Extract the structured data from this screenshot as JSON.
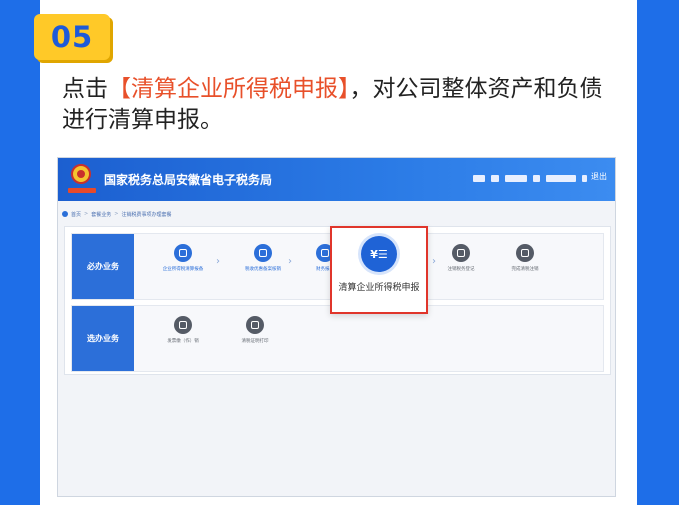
{
  "step": {
    "number": "05"
  },
  "instruction": {
    "prefix": "点击",
    "highlight": "【清算企业所得税申报】",
    "suffix": "，对公司整体资产和负债进行清算申报。"
  },
  "screenshot": {
    "site_title": "国家税务总局安徽省电子税务局",
    "header_exit": "退出",
    "breadcrumb": [
      "首页",
      "套餐业务",
      "注销税费事项办理套餐"
    ],
    "required": {
      "label": "必办业务",
      "items": [
        {
          "label": "企业所得税清算报备",
          "icon": "doc-edit-icon"
        },
        {
          "label": "税收优惠备案核销",
          "icon": "doc-edit-icon"
        },
        {
          "label": "财务报表",
          "icon": "clipboard-icon"
        },
        {
          "label": "注销税务登记",
          "icon": "building-icon"
        },
        {
          "label": "完成清税注销",
          "icon": "checkbox-icon"
        }
      ],
      "highlighted": {
        "label": "清算企业所得税申报",
        "icon_text": "¥☰"
      }
    },
    "optional": {
      "label": "选办业务",
      "items": [
        {
          "label": "发票缴（作）销",
          "icon": "stamp-icon"
        },
        {
          "label": "清税证明打印",
          "icon": "print-icon"
        }
      ]
    }
  },
  "colors": {
    "background": "#1e6ee8",
    "badge": "#ffc928",
    "highlight_text": "#e8502a",
    "callout_border": "#e0352b",
    "brand_blue": "#2c6fd9"
  }
}
